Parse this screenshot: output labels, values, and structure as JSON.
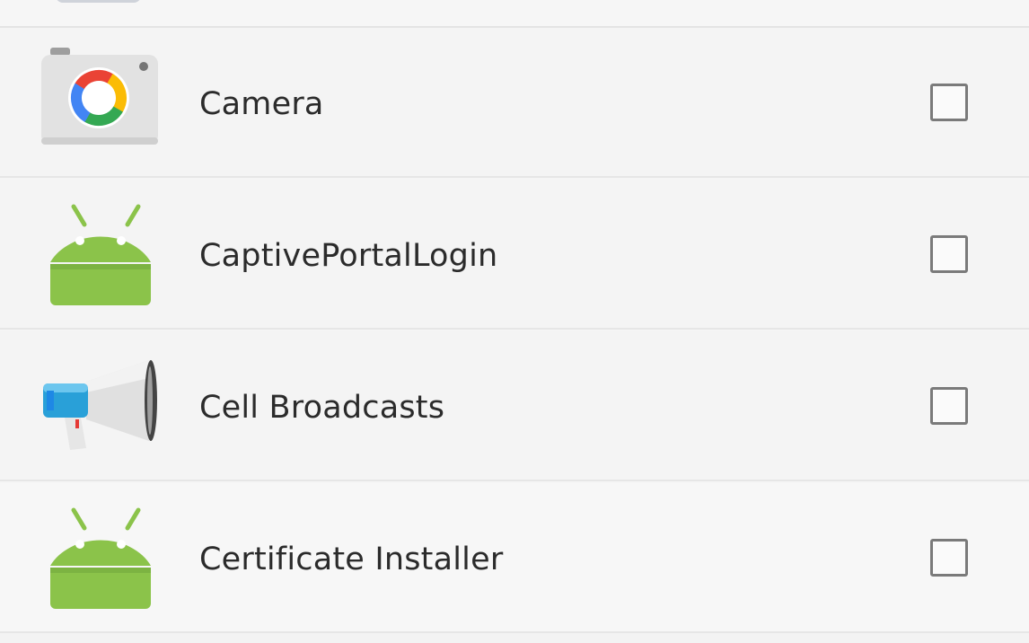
{
  "app_list": {
    "items": [
      {
        "label": "Camera",
        "icon": "camera-icon",
        "checked": false
      },
      {
        "label": "CaptivePortalLogin",
        "icon": "android-icon",
        "checked": false
      },
      {
        "label": "Cell Broadcasts",
        "icon": "megaphone-icon",
        "checked": false
      },
      {
        "label": "Certificate Installer",
        "icon": "android-icon",
        "checked": false
      }
    ]
  },
  "colors": {
    "background": "#f5f5f5",
    "divider": "#e6e6e6",
    "text": "#2b2b2b",
    "checkbox_border": "#7a7a7a",
    "android_green": "#8bc34a"
  }
}
